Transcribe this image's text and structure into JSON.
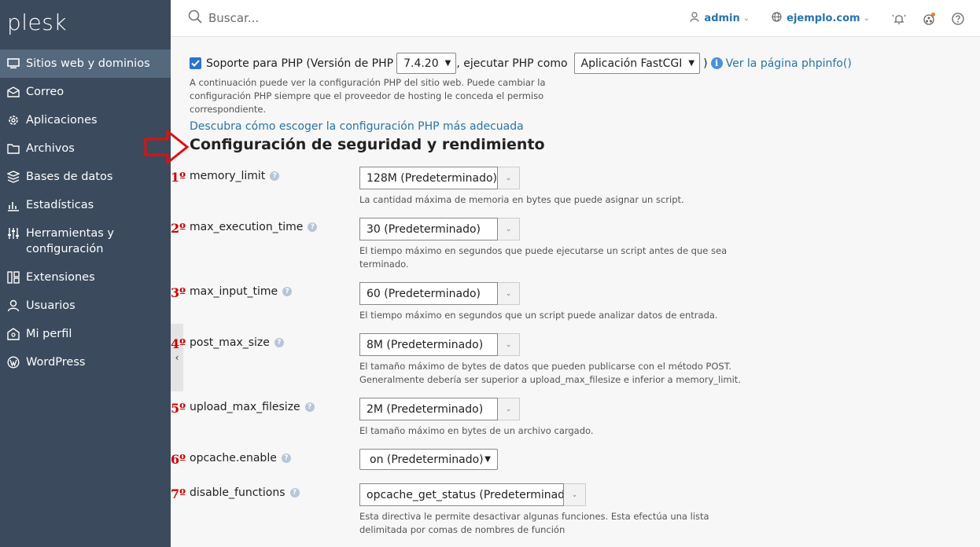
{
  "brand": "plesk",
  "nav": [
    {
      "label": "Sitios web y dominios",
      "icon": "monitor-icon",
      "active": true
    },
    {
      "label": "Correo",
      "icon": "mail-icon"
    },
    {
      "label": "Aplicaciones",
      "icon": "gear-icon"
    },
    {
      "label": "Archivos",
      "icon": "folder-icon"
    },
    {
      "label": "Bases de datos",
      "icon": "database-icon"
    },
    {
      "label": "Estadísticas",
      "icon": "stats-icon"
    },
    {
      "label": "Herramientas y configuración",
      "icon": "sliders-icon"
    },
    {
      "label": "Extensiones",
      "icon": "extensions-icon"
    },
    {
      "label": "Usuarios",
      "icon": "user-icon"
    },
    {
      "label": "Mi perfil",
      "icon": "profile-icon"
    },
    {
      "label": "WordPress",
      "icon": "wordpress-icon"
    }
  ],
  "topbar": {
    "search_placeholder": "Buscar...",
    "user": "admin",
    "domain": "ejemplo.com"
  },
  "php": {
    "label_start": "Soporte para PHP (Versión de PHP",
    "version": "7.4.20",
    "label_mid": ", ejecutar PHP como",
    "handler": "Aplicación FastCGI",
    "label_end": ")",
    "phpinfo_link": "Ver la página phpinfo()",
    "hint": "A continuación puede ver la configuración PHP del sitio web. Puede cambiar la configuración PHP siempre que el proveedor de hosting le conceda el permiso correspondiente.",
    "guide_link": "Descubra cómo escoger la configuración PHP más adecuada"
  },
  "section_title": "Configuración de seguridad y rendimiento",
  "fields": [
    {
      "num": "1º",
      "name": "memory_limit",
      "value": "128M (Predeterminado)",
      "hint": "La cantidad máxima de memoria en bytes que puede asignar un script."
    },
    {
      "num": "2º",
      "name": "max_execution_time",
      "value": "30 (Predeterminado)",
      "hint": "El tiempo máximo en segundos que puede ejecutarse un script antes de que sea terminado."
    },
    {
      "num": "3º",
      "name": "max_input_time",
      "value": "60 (Predeterminado)",
      "hint": "El tiempo máximo en segundos que un script puede analizar datos de entrada."
    },
    {
      "num": "4º",
      "name": "post_max_size",
      "value": "8M (Predeterminado)",
      "hint": "El tamaño máximo de bytes de datos que pueden publicarse con el método POST. Generalmente debería ser superior a upload_max_filesize e inferior a memory_limit."
    },
    {
      "num": "5º",
      "name": "upload_max_filesize",
      "value": "2M (Predeterminado)",
      "hint": "El tamaño máximo en bytes de un archivo cargado."
    },
    {
      "num": "6º",
      "name": "opcache.enable",
      "value": "on (Predeterminado)",
      "hint": ""
    },
    {
      "num": "7º",
      "name": "disable_functions",
      "value": "opcache_get_status (Predeterminado",
      "hint": "Esta directiva le permite desactivar algunas funciones. Esta efectúa una lista delimitada por comas de nombres de función"
    }
  ],
  "colors": {
    "sidebar": "#3b4a5c",
    "active": "#54687e",
    "link": "#2a73a8",
    "marker": "#cc0000"
  }
}
